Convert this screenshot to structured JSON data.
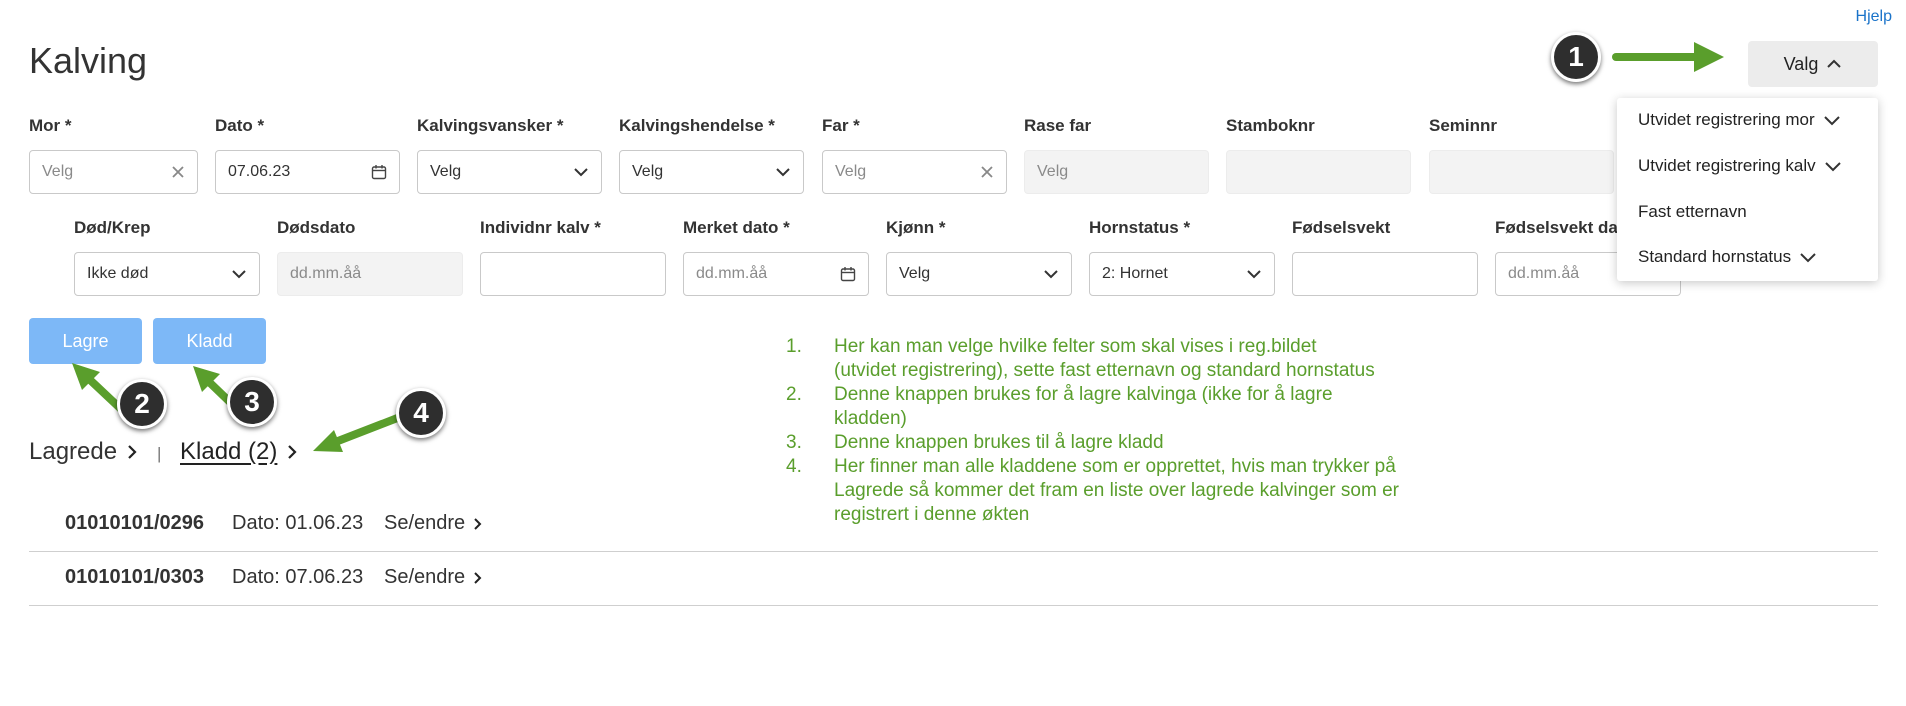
{
  "header": {
    "help": "Hjelp",
    "title": "Kalving",
    "valg_label": "Valg"
  },
  "valg_menu": {
    "items": [
      "Utvidet registrering mor",
      "Utvidet registrering kalv",
      "Fast etternavn",
      "Standard hornstatus"
    ]
  },
  "form": {
    "row1": {
      "mor": {
        "label": "Mor *",
        "placeholder": "Velg"
      },
      "dato": {
        "label": "Dato *",
        "value": "07.06.23"
      },
      "kalvingsvansker": {
        "label": "Kalvingsvansker *",
        "placeholder": "Velg"
      },
      "kalvingshendelse": {
        "label": "Kalvingshendelse *",
        "placeholder": "Velg"
      },
      "far": {
        "label": "Far *",
        "placeholder": "Velg"
      },
      "rase_far": {
        "label": "Rase far",
        "placeholder": "Velg"
      },
      "stamboknr": {
        "label": "Stamboknr"
      },
      "seminnr": {
        "label": "Seminnr"
      }
    },
    "row2": {
      "dod_krep": {
        "label": "Død/Krep",
        "value": "Ikke død"
      },
      "dodsdato": {
        "label": "Dødsdato",
        "placeholder": "dd.mm.åå"
      },
      "individnr_kalv": {
        "label": "Individnr kalv *"
      },
      "merket_dato": {
        "label": "Merket dato *",
        "placeholder": "dd.mm.åå"
      },
      "kjonn": {
        "label": "Kjønn *",
        "placeholder": "Velg"
      },
      "hornstatus": {
        "label": "Hornstatus *",
        "value": "2: Hornet"
      },
      "fodselsvekt": {
        "label": "Fødselsvekt"
      },
      "fodselsvekt_dato": {
        "label": "Fødselsvekt da",
        "placeholder": "dd.mm.åå"
      }
    }
  },
  "buttons": {
    "lagre": "Lagre",
    "kladd": "Kladd"
  },
  "tabs": {
    "lagrede": "Lagrede",
    "separator": "|",
    "kladd": "Kladd (2)"
  },
  "kladd_list": [
    {
      "id": "01010101/0296",
      "date": "Dato: 01.06.23",
      "action": "Se/endre"
    },
    {
      "id": "01010101/0303",
      "date": "Dato: 07.06.23",
      "action": "Se/endre"
    }
  ],
  "annotations": {
    "markers": [
      "1",
      "2",
      "3",
      "4"
    ],
    "notes": [
      {
        "num": "1.",
        "lines": [
          "Her kan man velge hvilke felter som skal vises i reg.bildet",
          "(utvidet registrering), sette fast etternavn og standard      hornstatus"
        ]
      },
      {
        "num": "2.",
        "lines": [
          "Denne knappen brukes for å lagre kalvinga (ikke for å lagre",
          "kladden)"
        ]
      },
      {
        "num": "3.",
        "lines": [
          "Denne knappen brukes til å lagre kladd"
        ]
      },
      {
        "num": "4.",
        "lines": [
          "Her finner man alle kladdene som er opprettet, hvis man  trykker på",
          "Lagrede så kommer det fram en liste over lagrede kalvinger som er",
          "registrert i denne økten"
        ]
      }
    ],
    "color": "#5a9e2c"
  }
}
